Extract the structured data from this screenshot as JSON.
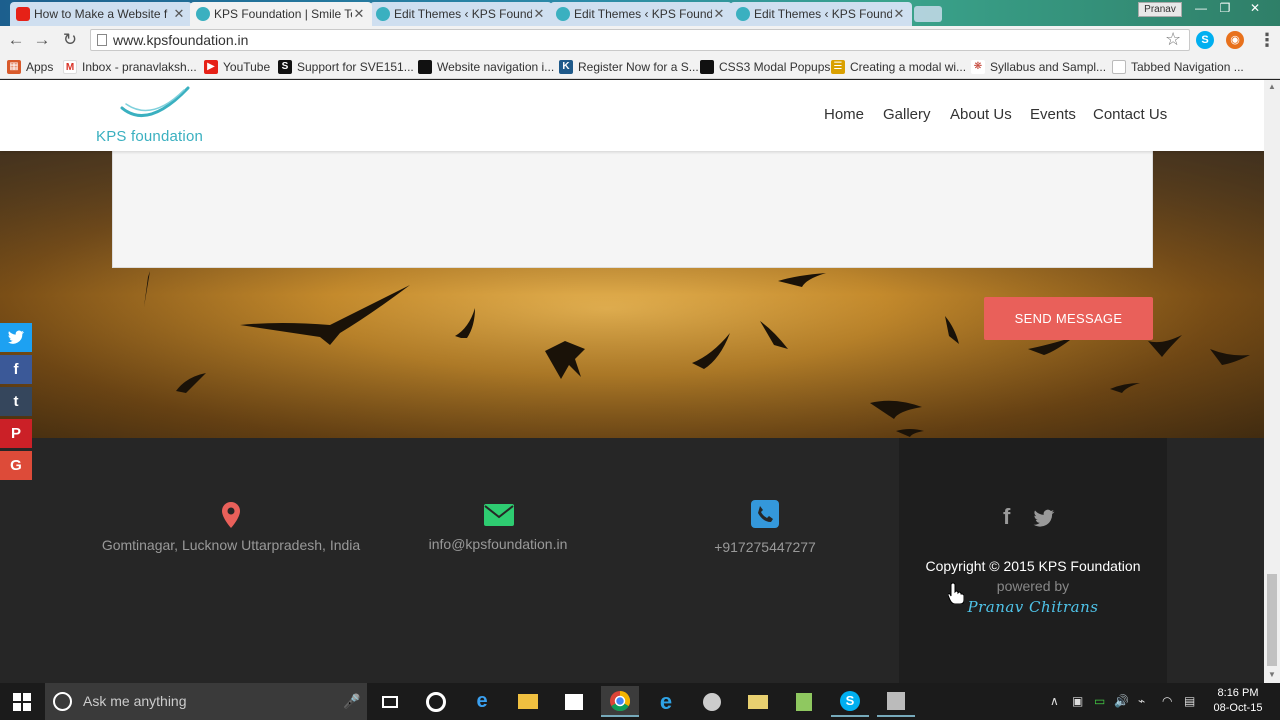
{
  "browser": {
    "tabs": [
      {
        "label": "How to Make a Website f",
        "favicon": "youtube-icon",
        "color": "#e62117"
      },
      {
        "label": "KPS Foundation | Smile To",
        "favicon": "kps-logo-icon",
        "color": "#3ab0c0",
        "active": true
      },
      {
        "label": "Edit Themes ‹ KPS Founda",
        "favicon": "kps-logo-icon",
        "color": "#3ab0c0"
      },
      {
        "label": "Edit Themes ‹ KPS Founda",
        "favicon": "kps-logo-icon",
        "color": "#3ab0c0"
      },
      {
        "label": "Edit Themes ‹ KPS Founda",
        "favicon": "kps-logo-icon",
        "color": "#3ab0c0"
      }
    ],
    "user_chip": "Pranav",
    "url": "www.kpsfoundation.in",
    "bookmarks": [
      {
        "label": "Apps",
        "icon": "apps-grid-icon",
        "color": "#d85a2b"
      },
      {
        "label": "Inbox - pranavlaksh...",
        "icon": "gmail-icon",
        "color": "#d93025"
      },
      {
        "label": "YouTube",
        "icon": "youtube-icon",
        "color": "#e62117"
      },
      {
        "label": "Support for SVE151...",
        "icon": "sony-icon",
        "color": "#111111"
      },
      {
        "label": "Website navigation i...",
        "icon": "page-icon",
        "color": "#111111"
      },
      {
        "label": "Register Now for a S...",
        "icon": "k-icon",
        "color": "#1f5a8a"
      },
      {
        "label": "CSS3 Modal Popups",
        "icon": "page-icon",
        "color": "#111111"
      },
      {
        "label": "Creating a modal wi...",
        "icon": "stack-icon",
        "color": "#d9a000"
      },
      {
        "label": "Syllabus and Sampl...",
        "icon": "cbse-icon",
        "color": "#c0392b"
      },
      {
        "label": "Tabbed Navigation ...",
        "icon": "doc-icon",
        "color": "#888888"
      }
    ]
  },
  "site": {
    "logo_text": "KPS foundation",
    "nav": [
      "Home",
      "Gallery",
      "About Us",
      "Events",
      "Contact Us"
    ],
    "send_button": "SEND MESSAGE",
    "social_float": [
      {
        "name": "twitter-icon",
        "glyph": "🐦",
        "color": "#1da1f2"
      },
      {
        "name": "facebook-icon",
        "glyph": "f",
        "color": "#3b5998"
      },
      {
        "name": "tumblr-icon",
        "glyph": "t",
        "color": "#35465c"
      },
      {
        "name": "pinterest-icon",
        "glyph": "P",
        "color": "#cb2027"
      },
      {
        "name": "google-plus-icon",
        "glyph": "G",
        "color": "#dd4b39"
      }
    ],
    "footer": {
      "address": "Gomtinagar, Lucknow Uttarpradesh, India",
      "email": "info@kpsfoundation.in",
      "phone": "+917275447277",
      "copyright": "Copyright © 2015 KPS Foundation",
      "powered_by": "powered by",
      "author": "Pranav Chitrans",
      "colors": {
        "location": "#e9605a",
        "email": "#2ecc71",
        "phone": "#3498db"
      }
    }
  },
  "taskbar": {
    "search_placeholder": "Ask me anything",
    "time": "8:16 PM",
    "date": "08-Oct-15"
  }
}
